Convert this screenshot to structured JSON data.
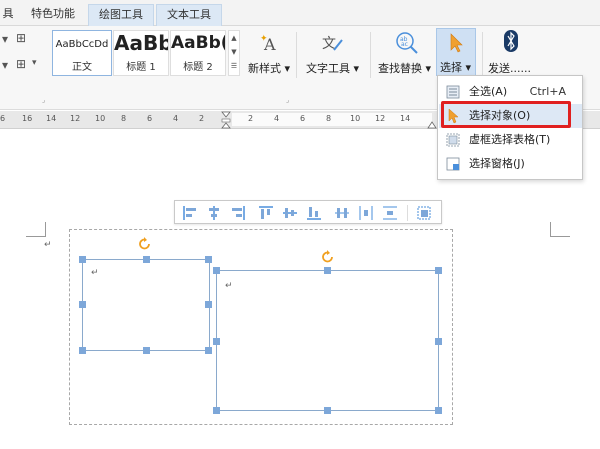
{
  "tabs": [
    {
      "label": "具",
      "active": false
    },
    {
      "label": "特色功能",
      "active": false
    },
    {
      "label": "绘图工具",
      "active": true
    },
    {
      "label": "文本工具",
      "active": true
    }
  ],
  "styles": [
    {
      "sample": "AaBbCcDd",
      "name": "正文"
    },
    {
      "sample": "AaBb",
      "name": "标题 1"
    },
    {
      "sample": "AaBb(",
      "name": "标题 2"
    }
  ],
  "ribbon": {
    "new_style": "新样式",
    "text_tool": "文字工具",
    "find_replace": "查找替换",
    "select": "选择",
    "send": "发送......"
  },
  "ruler_labels": [
    "6",
    "16",
    "14",
    "12",
    "10",
    "8",
    "6",
    "4",
    "2",
    "2",
    "4",
    "6",
    "8",
    "10",
    "12",
    "14",
    "18"
  ],
  "menu": {
    "items": [
      {
        "label": "全选(A)",
        "shortcut": "Ctrl+A"
      },
      {
        "label": "选择对象(O)",
        "shortcut": ""
      },
      {
        "label": "虚框选择表格(T)",
        "shortcut": ""
      },
      {
        "label": "选择窗格(J)",
        "shortcut": ""
      }
    ]
  },
  "paragraph_mark": "↵",
  "colors": {
    "accent": "#4a8fdb",
    "handle": "#7da7d9",
    "rotate": "#f0a020",
    "highlight": "#e02020",
    "menu_hover": "#dde8f5"
  }
}
